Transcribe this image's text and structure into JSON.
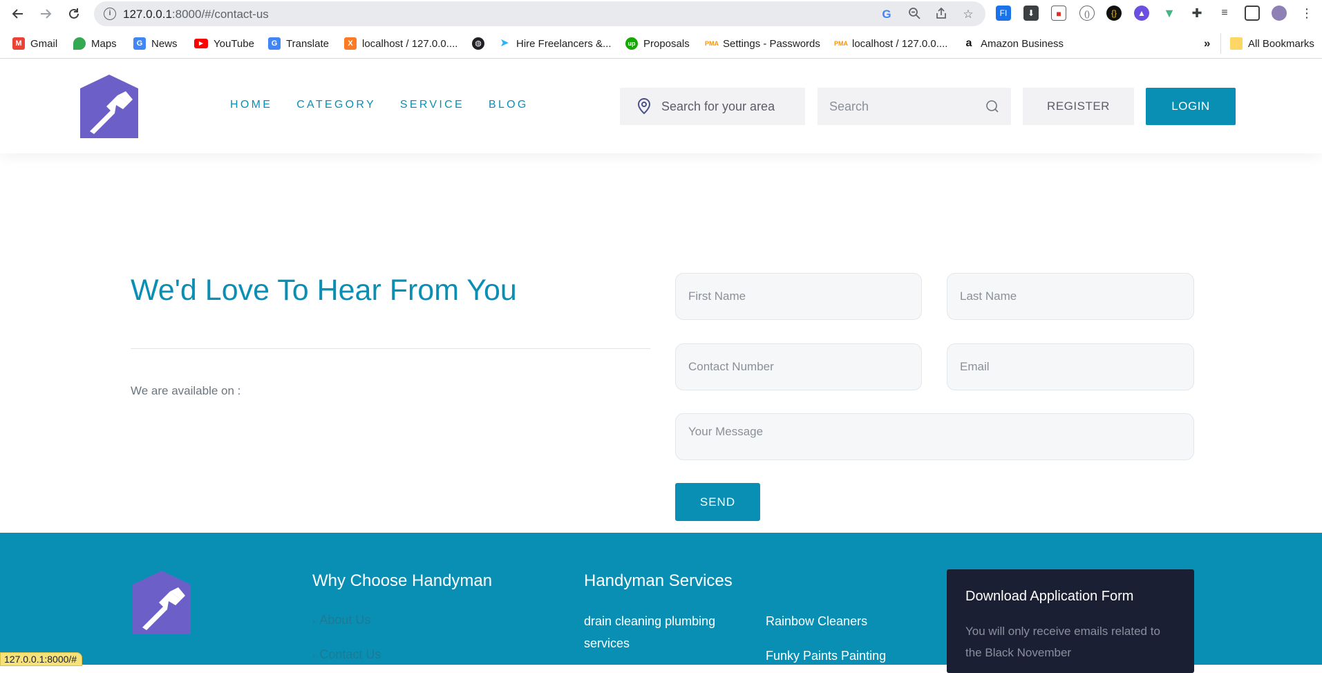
{
  "browser": {
    "url_host": "127.0.0.1",
    "url_path": ":8000/#/contact-us",
    "bookmarks": [
      {
        "label": "Gmail",
        "icon": "gmail-icon"
      },
      {
        "label": "Maps",
        "icon": "maps-icon"
      },
      {
        "label": "News",
        "icon": "news-icon"
      },
      {
        "label": "YouTube",
        "icon": "youtube-icon"
      },
      {
        "label": "Translate",
        "icon": "translate-icon"
      },
      {
        "label": "localhost / 127.0.0....",
        "icon": "xampp-icon"
      },
      {
        "label": "",
        "icon": "globe-icon"
      },
      {
        "label": "Hire Freelancers &...",
        "icon": "freelancer-icon"
      },
      {
        "label": "Proposals",
        "icon": "upwork-icon"
      },
      {
        "label": "Settings - Passwords",
        "icon": "phpmyadmin-icon"
      },
      {
        "label": "localhost / 127.0.0....",
        "icon": "phpmyadmin-icon"
      },
      {
        "label": "Amazon Business",
        "icon": "amazon-icon"
      }
    ],
    "overflow_label": "»",
    "all_bookmarks": "All Bookmarks",
    "status_url": "127.0.0.1:8000/#"
  },
  "header": {
    "nav": [
      "HOME",
      "CATEGORY",
      "SERVICE",
      "BLOG"
    ],
    "area_placeholder": "Search for your area",
    "search_placeholder": "Search",
    "register_label": "REGISTER",
    "login_label": "LOGIN",
    "accent_color": "#0a8fb4",
    "logo_color": "#6c5fc7"
  },
  "contact": {
    "title": "We'd Love To Hear From You",
    "availability": "We are available on :",
    "first_name_placeholder": "First Name",
    "last_name_placeholder": "Last Name",
    "contact_number_placeholder": "Contact Number",
    "email_placeholder": "Email",
    "message_placeholder": "Your Message",
    "send_label": "SEND"
  },
  "footer": {
    "why_heading": "Why Choose Handyman",
    "why_links": [
      "About Us",
      "Contact Us"
    ],
    "services_heading": "Handyman Services",
    "services_col1": [
      "drain cleaning plumbing services"
    ],
    "services_col2": [
      "Rainbow Cleaners",
      "Funky Paints Painting"
    ],
    "download_title": "Download Application Form",
    "download_desc": "You will only receive emails related to the Black November",
    "card_color": "#1b1f33"
  }
}
